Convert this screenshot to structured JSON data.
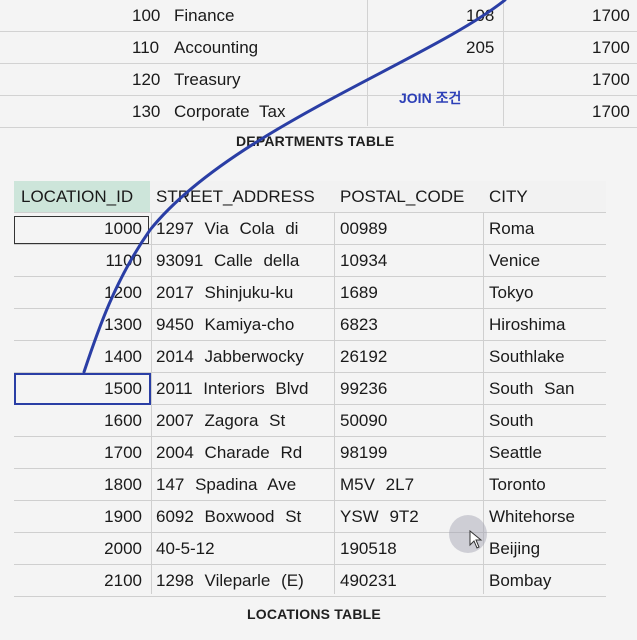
{
  "departments": {
    "rows": [
      {
        "id": "100",
        "name": "Finance",
        "manager": "108",
        "location": "1700"
      },
      {
        "id": "110",
        "name": "Accounting",
        "manager": "205",
        "location": "1700"
      },
      {
        "id": "120",
        "name": "Treasury",
        "manager": "",
        "location": "1700"
      },
      {
        "id": "130",
        "name": "Corporate  Tax",
        "manager": "",
        "location": "1700"
      }
    ],
    "caption": "DEPARTMENTS TABLE"
  },
  "join_label": "JOIN 조건",
  "locations": {
    "headers": [
      "LOCATION_ID",
      "STREET_ADDRESS",
      "POSTAL_CODE",
      "CITY"
    ],
    "rows": [
      {
        "location_id": "1000",
        "street_address": "1297  Via  Cola  di",
        "postal_code": "00989",
        "city": "Roma"
      },
      {
        "location_id": "1100",
        "street_address": "93091  Calle  della",
        "postal_code": "10934",
        "city": "Venice"
      },
      {
        "location_id": "1200",
        "street_address": "2017  Shinjuku-ku",
        "postal_code": "1689",
        "city": "Tokyo"
      },
      {
        "location_id": "1300",
        "street_address": "9450  Kamiya-cho",
        "postal_code": "6823",
        "city": "Hiroshima"
      },
      {
        "location_id": "1400",
        "street_address": "2014  Jabberwocky",
        "postal_code": "26192",
        "city": "Southlake"
      },
      {
        "location_id": "1500",
        "street_address": "2011  Interiors  Blvd",
        "postal_code": "99236",
        "city": "South  San"
      },
      {
        "location_id": "1600",
        "street_address": "2007  Zagora  St",
        "postal_code": "50090",
        "city": "South"
      },
      {
        "location_id": "1700",
        "street_address": "2004  Charade  Rd",
        "postal_code": "98199",
        "city": "Seattle"
      },
      {
        "location_id": "1800",
        "street_address": "147  Spadina  Ave",
        "postal_code": "M5V  2L7",
        "city": "Toronto"
      },
      {
        "location_id": "1900",
        "street_address": "6092  Boxwood  St",
        "postal_code": "YSW  9T2",
        "city": "Whitehorse"
      },
      {
        "location_id": "2000",
        "street_address": "40-5-12",
        "postal_code": "190518",
        "city": "Beijing"
      },
      {
        "location_id": "2100",
        "street_address": "1298  Vileparle  (E)",
        "postal_code": "490231",
        "city": "Bombay"
      }
    ],
    "caption": "LOCATIONS TABLE"
  },
  "colors": {
    "join_line": "#2a3ea5",
    "header_highlight": "#cde5da",
    "grid": "#cfcfcf"
  }
}
